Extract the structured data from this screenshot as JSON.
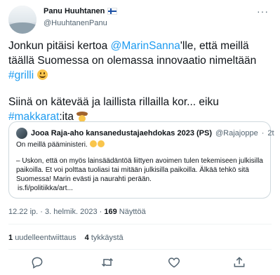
{
  "author": {
    "display_name": "Panu Huuhtanen",
    "handle": "@HuuhtanenPanu",
    "flag": "finland-flag",
    "more_label": "···"
  },
  "tweet": {
    "p1_a": "Jonkun pitäisi kertoa ",
    "p1_mention": "@MarinSanna",
    "p1_b": "'lle, että meillä täällä Suomessa on olemassa innovaatio nimeltään ",
    "p1_hashtag": "#grilli",
    "p2_a": "Siinä on kätevää ja laillista rillailla kor... eiku ",
    "p2_hashtag": "#makkarat",
    "p2_b": ":ita"
  },
  "quote": {
    "name": "Jooa Raja-aho kansanedustajaehdokas 2023 (PS)",
    "handle": "@Rajajoppe",
    "dot": "·",
    "time": "2t",
    "line1": "On meillä pääministeri.",
    "line2": "– Uskon, että on myös lainsäädäntöä liittyen avoimen tulen tekemiseen julkisilla paikoilla. Et voi polttaa tuoliasi tai mitään julkisilla paikoilla. Älkää tehkö sitä Suomessa! Marin evästi ja naurahti perään.",
    "link": "is.fi/politiikka/art..."
  },
  "meta": {
    "time": "12.22 ip.",
    "sep": " · ",
    "date": "3. helmik. 2023",
    "views_count": "169",
    "views_label": "Näyttöä"
  },
  "stats": {
    "retweets_count": "1",
    "retweets_label": "uudelleentwiittaus",
    "likes_count": "4",
    "likes_label": "tykkäystä"
  },
  "actions": [
    "reply-icon",
    "retweet-icon",
    "like-icon",
    "share-icon"
  ],
  "colors": {
    "link": "#1d9bf0",
    "secondary_text": "#536471",
    "border": "#cfd9de"
  }
}
